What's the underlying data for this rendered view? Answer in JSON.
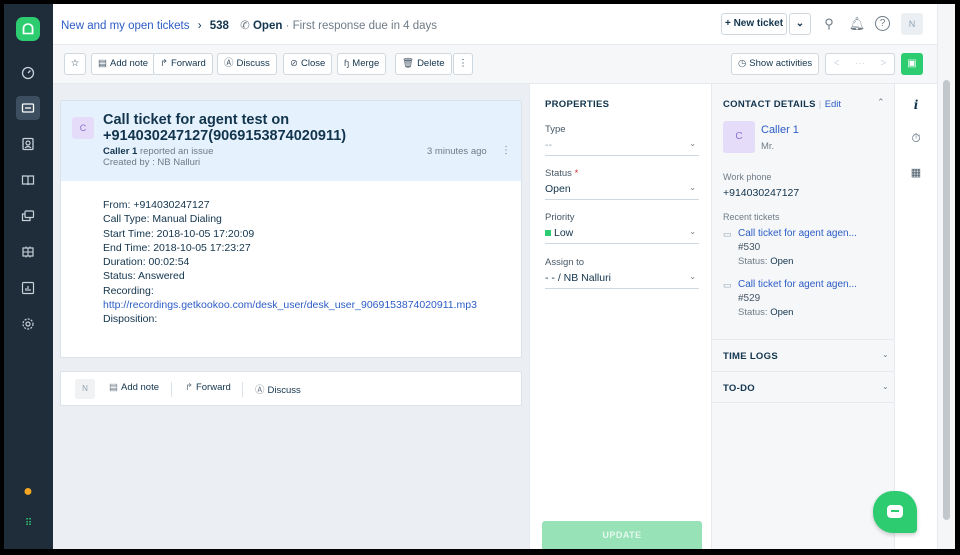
{
  "header": {
    "breadcrumb_link": "New and my open tickets",
    "ticket_number": "538",
    "status": "Open",
    "due_text": "· First response due in 4 days",
    "new_ticket_label": "+ New ticket",
    "user_initial": "N"
  },
  "toolbar": {
    "add_note": "Add note",
    "forward": "Forward",
    "discuss": "Discuss",
    "close": "Close",
    "merge": "Merge",
    "delete": "Delete",
    "show_activities": "Show activities",
    "nav_prev": "<",
    "nav_mid": "···",
    "nav_next": ">"
  },
  "ticket": {
    "requester_initial": "C",
    "subject_line1": "Call ticket for agent test on",
    "subject_line2": "+914030247127(9069153874020911)",
    "requester_name": "Caller 1",
    "reported_text": " reported an issue",
    "created_by": "Created by : NB Nalluri",
    "time_ago": "3 minutes ago",
    "body": {
      "from": "From: +914030247127",
      "call_type": "Call Type: Manual Dialing",
      "start_time": "Start Time: 2018-10-05 17:20:09",
      "end_time": "End Time: 2018-10-05 17:23:27",
      "duration": "Duration: 00:02:54",
      "status": "Status: Answered",
      "recording_label": "Recording:",
      "recording_url": "http://recordings.getkookoo.com/desk_user/desk_user_9069153874020911.mp3",
      "disposition": "Disposition:"
    }
  },
  "reply": {
    "agent_initial": "N",
    "add_note": "Add note",
    "forward": "Forward",
    "discuss": "Discuss"
  },
  "properties": {
    "title": "PROPERTIES",
    "type_label": "Type",
    "type_value": "--",
    "status_label": "Status",
    "status_required": "*",
    "status_value": "Open",
    "priority_label": "Priority",
    "priority_value": "Low",
    "priority_color": "#2ecc71",
    "assign_label": "Assign to",
    "assign_value": "- - / NB Nalluri",
    "update_label": "UPDATE"
  },
  "contact": {
    "title": "CONTACT DETAILS",
    "edit": "Edit",
    "initial": "C",
    "name": "Caller 1",
    "salutation": "Mr.",
    "work_phone_label": "Work phone",
    "work_phone": "+914030247127",
    "recent_tickets_label": "Recent tickets",
    "recent_tickets": [
      {
        "title": "Call ticket for agent agen...",
        "id": "#530",
        "status_label": "Status: ",
        "status": "Open"
      },
      {
        "title": "Call ticket for agent agen...",
        "id": "#529",
        "status_label": "Status: ",
        "status": "Open"
      }
    ],
    "time_logs": "TIME LOGS",
    "todo": "TO-DO"
  },
  "colors": {
    "brand_green": "#2ecc71",
    "nav_dark": "#1f2d3a",
    "link_blue": "#2c5cc5"
  }
}
